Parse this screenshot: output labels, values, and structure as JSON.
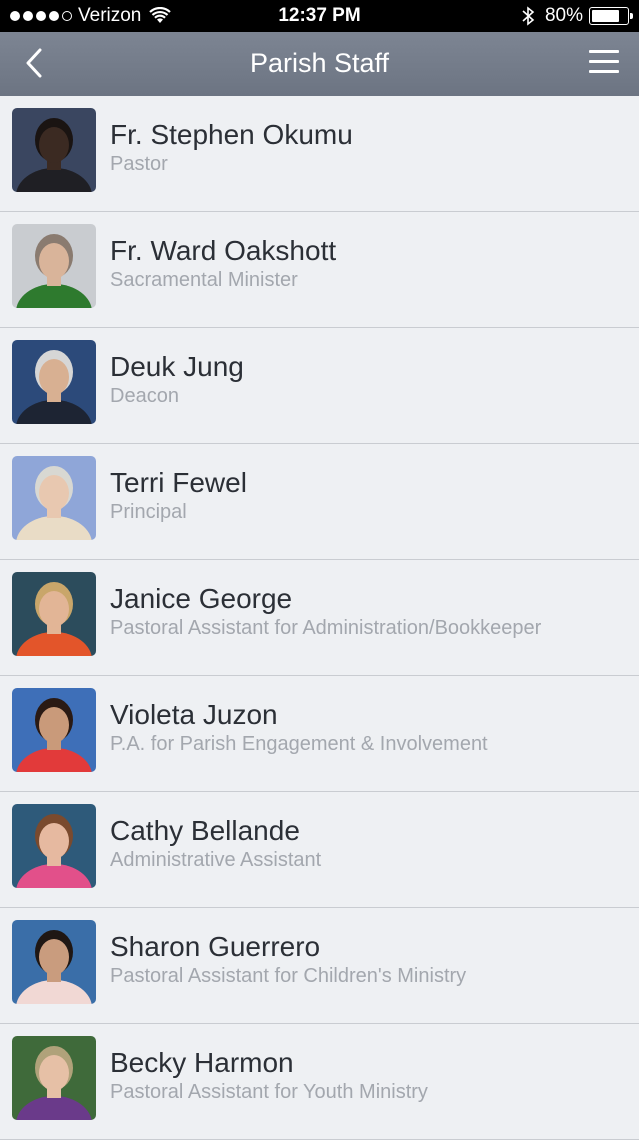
{
  "status_bar": {
    "carrier": "Verizon",
    "time": "12:37 PM",
    "battery_percent": "80%",
    "battery_level": 0.8
  },
  "nav": {
    "title": "Parish Staff",
    "back_icon": "chevron-left-icon",
    "menu_icon": "hamburger-menu-icon"
  },
  "staff": [
    {
      "name": "Fr. Stephen Okumu",
      "role": "Pastor",
      "bg": "#3a4660",
      "skin": "#3b2a22",
      "hair": "#1a1412",
      "shirt": "#1f1f24"
    },
    {
      "name": "Fr. Ward Oakshott",
      "role": "Sacramental Minister",
      "bg": "#c9ccd0",
      "skin": "#d9b49a",
      "hair": "#8a7b70",
      "shirt": "#2e7a2e"
    },
    {
      "name": "Deuk Jung",
      "role": "Deacon",
      "bg": "#2c4a7a",
      "skin": "#d8b092",
      "hair": "#d6d6d6",
      "shirt": "#1d2433"
    },
    {
      "name": "Terri Fewel",
      "role": "Principal",
      "bg": "#8fa6d8",
      "skin": "#e8c8b0",
      "hair": "#d8d8d2",
      "shirt": "#e9dcc6"
    },
    {
      "name": "Janice George",
      "role": "Pastoral Assistant for Administration/Bookkeeper",
      "bg": "#2c4c5c",
      "skin": "#e2b596",
      "hair": "#c9a66a",
      "shirt": "#e3552a"
    },
    {
      "name": "Violeta Juzon",
      "role": "P.A. for Parish Engagement & Involvement",
      "bg": "#3e6fb8",
      "skin": "#c99a7a",
      "hair": "#2a1a14",
      "shirt": "#e23a3a"
    },
    {
      "name": "Cathy Bellande",
      "role": "Administrative Assistant",
      "bg": "#2e5a7a",
      "skin": "#e6b9a0",
      "hair": "#7a4a2e",
      "shirt": "#e2508a"
    },
    {
      "name": "Sharon Guerrero",
      "role": "Pastoral Assistant for Children's Ministry",
      "bg": "#3a6ea8",
      "skin": "#c99c7e",
      "hair": "#1f1714",
      "shirt": "#f1d8d4"
    },
    {
      "name": "Becky Harmon",
      "role": "Pastoral Assistant for Youth Ministry",
      "bg": "#3f6a3a",
      "skin": "#e6c0a6",
      "hair": "#b0a27a",
      "shirt": "#6a3a8a"
    }
  ]
}
